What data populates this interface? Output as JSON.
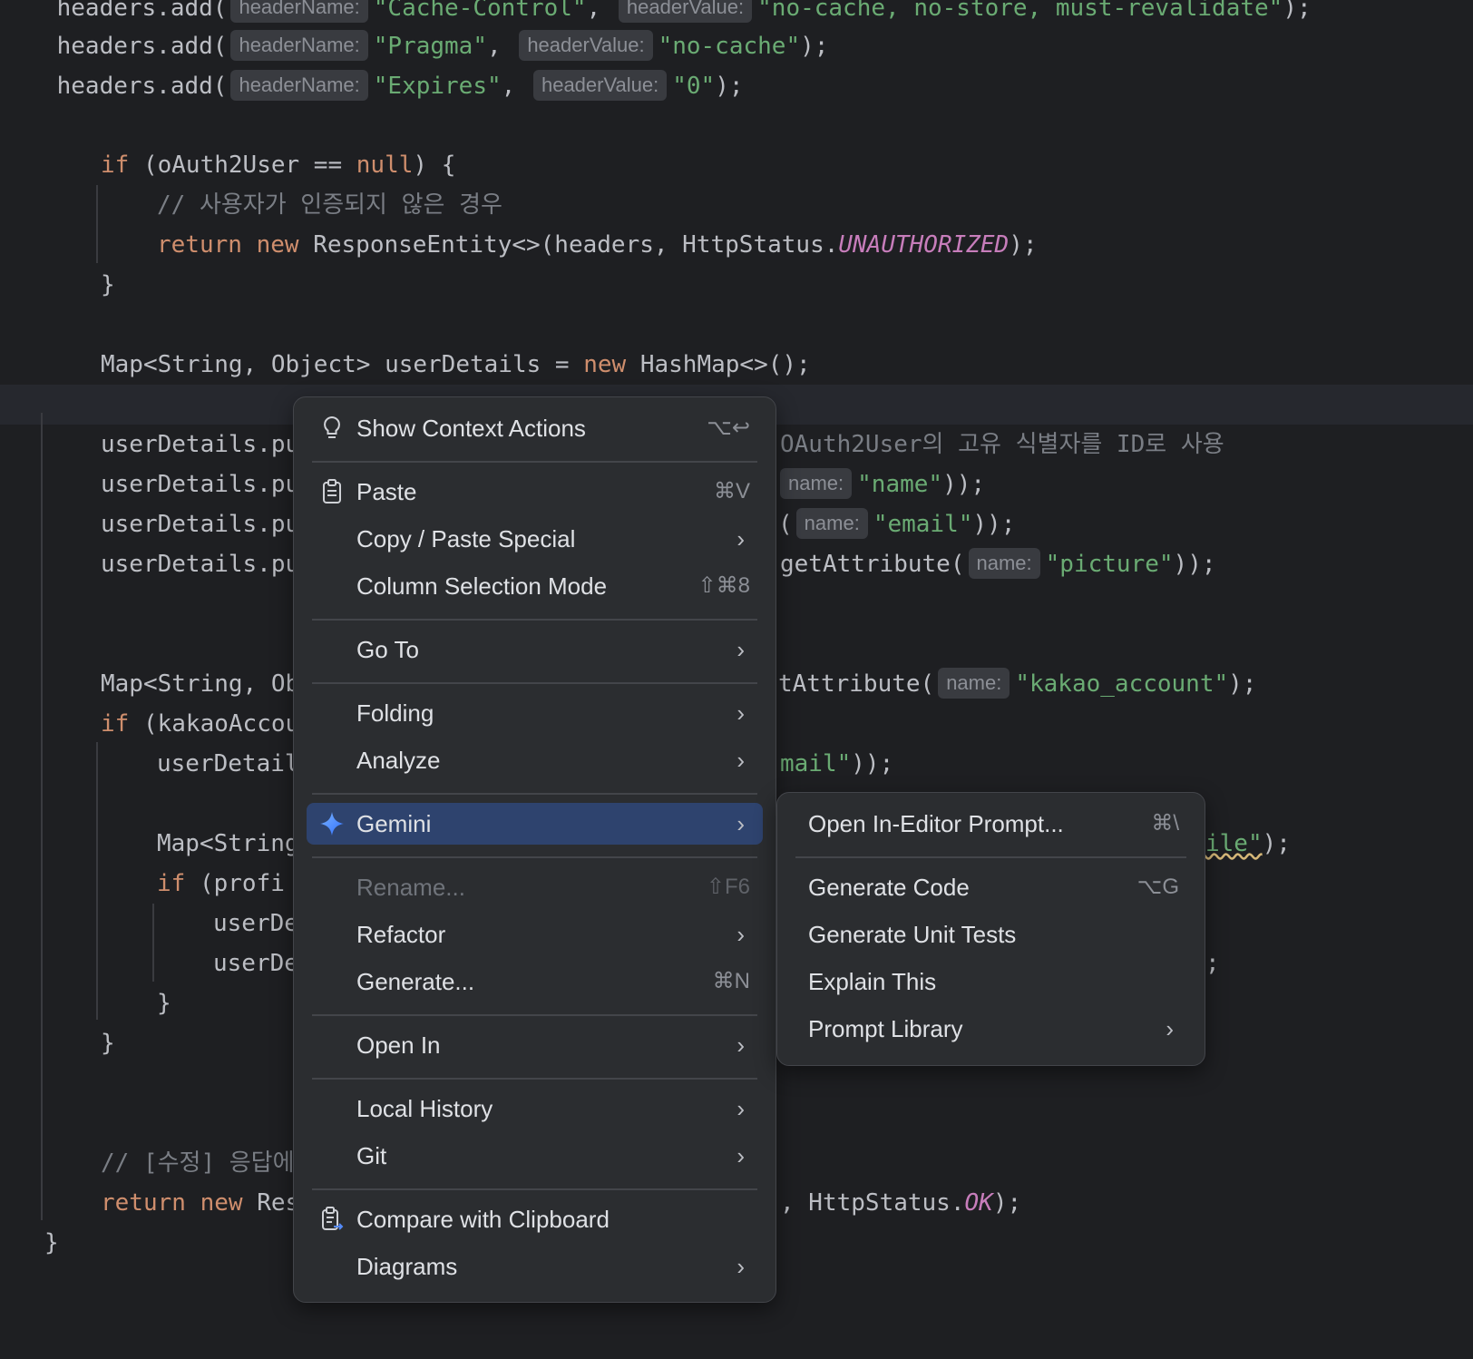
{
  "editor": {
    "l1": {
      "pre": "    headers.add(",
      "h1": "headerName:",
      "s1": "\"Cache-Control\"",
      "mid": ", ",
      "h2": "headerValue:",
      "s2": "\"no-cache, no-store, must-revalidate\"",
      "end": ");"
    },
    "l2": {
      "pre": "    headers.add(",
      "h1": "headerName:",
      "s1": "\"Pragma\"",
      "mid": ", ",
      "h2": "headerValue:",
      "s2": "\"no-cache\"",
      "end": ");"
    },
    "l3": {
      "pre": "    headers.add(",
      "h1": "headerName:",
      "s1": "\"Expires\"",
      "mid": ", ",
      "h2": "headerValue:",
      "s2": "\"0\"",
      "end": ");"
    },
    "l4": {
      "kw": "if",
      "mid": " (oAuth2User == ",
      "kw2": "null",
      "end": ") {"
    },
    "l5": {
      "comment": "// 사용자가 인증되지 않은 경우"
    },
    "l6": {
      "kw": "return",
      "kw2": "new",
      "mid": " ResponseEntity<>(headers, HttpStatus.",
      "const": "UNAUTHORIZED",
      "end": ");"
    },
    "l7": {
      "text": "}"
    },
    "l8": {
      "pre": "Map<String, Object> userDetails = ",
      "kw": "new",
      "end": " HashMap<>();"
    },
    "l9": {
      "pre": "userDetails.pu",
      "tail": "OAuth2User의 고유 식별자를 ID로 사용"
    },
    "l10": {
      "pre": "userDetails.pu",
      "hint": "name:",
      "str": "\"name\"",
      "end": "));"
    },
    "l11": {
      "pre": "userDetails.pu",
      "tail": "(",
      "hint": "name:",
      "str": "\"email\"",
      "end": "));"
    },
    "l12": {
      "pre": "userDetails.pu",
      "tail": "getAttribute(",
      "hint": "name:",
      "str": "\"picture\"",
      "end": "));"
    },
    "l13": {
      "pre": "Map<String, Ob",
      "tail": "tAttribute(",
      "hint": "name:",
      "str": "\"kakao_account\"",
      "end": ");"
    },
    "l14": {
      "kw": "if",
      "pre": " (kakaoAccou"
    },
    "l15": {
      "pre": "userDetail",
      "str": "mail\"",
      "end": "));"
    },
    "l16": {
      "pre": "Map<String",
      "str": "ile\"",
      "end": ");"
    },
    "l17": {
      "kw": "if",
      "pre": " (profi"
    },
    "l18": {
      "pre": "userDe"
    },
    "l19": {
      "pre": "userDe",
      "end": ";"
    },
    "l20": {
      "text": "}"
    },
    "l21": {
      "text": "}"
    },
    "l22": {
      "comment": "// [수정] 응답에"
    },
    "l23": {
      "kw": "return",
      "kw2": "new",
      "pre": " Res",
      "tail": ", HttpStatus.",
      "const": "OK",
      "end": ");"
    },
    "l24": {
      "text": "}"
    }
  },
  "context_menu": {
    "show_context_actions": {
      "label": "Show Context Actions",
      "shortcut": "⌥↩",
      "icon": "lightbulb-icon"
    },
    "paste": {
      "label": "Paste",
      "shortcut": "⌘V",
      "icon": "clipboard-icon"
    },
    "copy_paste_special": {
      "label": "Copy / Paste Special"
    },
    "column_selection_mode": {
      "label": "Column Selection Mode",
      "shortcut": "⇧⌘8"
    },
    "go_to": {
      "label": "Go To"
    },
    "folding": {
      "label": "Folding"
    },
    "analyze": {
      "label": "Analyze"
    },
    "gemini": {
      "label": "Gemini",
      "icon": "gemini-sparkle-icon"
    },
    "rename": {
      "label": "Rename...",
      "shortcut": "⇧F6"
    },
    "refactor": {
      "label": "Refactor"
    },
    "generate": {
      "label": "Generate...",
      "shortcut": "⌘N"
    },
    "open_in": {
      "label": "Open In"
    },
    "local_history": {
      "label": "Local History"
    },
    "git": {
      "label": "Git"
    },
    "compare_clipboard": {
      "label": "Compare with Clipboard",
      "icon": "compare-clipboard-icon"
    },
    "diagrams": {
      "label": "Diagrams"
    }
  },
  "gemini_submenu": {
    "open_prompt": {
      "label": "Open In-Editor Prompt...",
      "shortcut": "⌘\\"
    },
    "generate_code": {
      "label": "Generate Code",
      "shortcut": "⌥G"
    },
    "generate_tests": {
      "label": "Generate Unit Tests"
    },
    "explain": {
      "label": "Explain This"
    },
    "prompt_library": {
      "label": "Prompt Library"
    }
  },
  "colors": {
    "background": "#1e1f22",
    "menu": "#2b2d30",
    "selected": "#2e436e",
    "keyword": "#cf8e6d",
    "string": "#6aab73",
    "comment": "#7a7e85",
    "constant": "#c77dbb"
  }
}
